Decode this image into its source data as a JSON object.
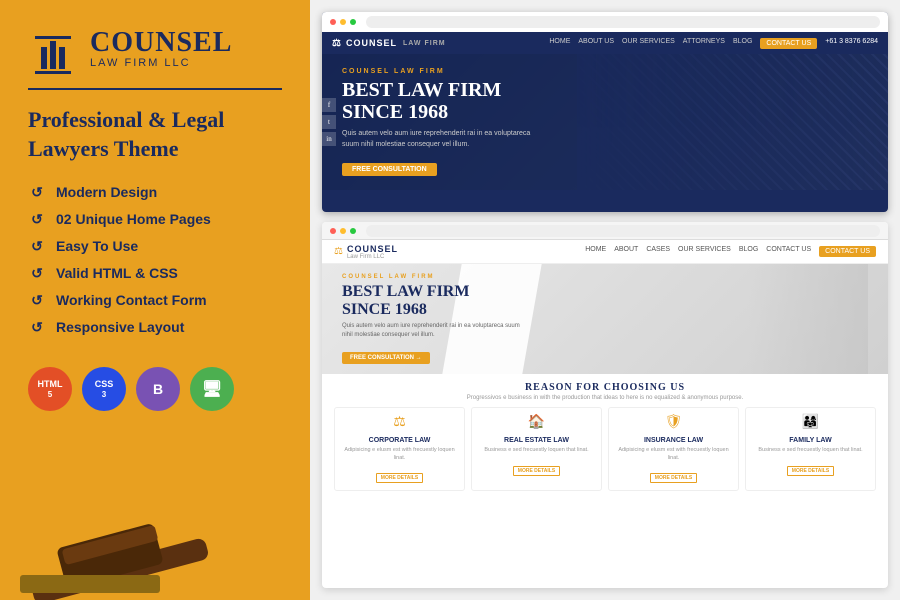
{
  "left": {
    "logo": {
      "main": "CoUNSEL",
      "firm": "Law Firm LLC"
    },
    "tagline": "Professional & Legal Lawyers Theme",
    "features": [
      "Modern Design",
      "02 Unique Home Pages",
      "Easy To Use",
      "Valid HTML & CSS",
      "Working Contact Form",
      "Responsive Layout"
    ],
    "badges": [
      {
        "id": "html5",
        "top": "HTML",
        "num": "5"
      },
      {
        "id": "css3",
        "top": "CSS",
        "num": "3"
      },
      {
        "id": "bootstrap",
        "top": "B",
        "num": ""
      },
      {
        "id": "rwd",
        "top": "RWD",
        "num": ""
      }
    ]
  },
  "right": {
    "browser_top": {
      "nav": {
        "logo": "Counsel",
        "links": [
          "HOME",
          "ABOUT US",
          "OUR SERVICES",
          "ATTORNEYS",
          "BLOG"
        ],
        "contact_btn": "CONTACT US",
        "phone": "+61 3 8376 6284"
      },
      "hero": {
        "label": "COUNSEL LAW FIRM",
        "title": "BEST LAW FIRM\nSINCE 1968",
        "desc": "Quis autem velo aum iure reprehenderit rai in ea voluptareca suum nihil molestiae consequer vel illum.",
        "btn": "FREE CONSULTATION"
      }
    },
    "browser_bottom": {
      "nav": {
        "logo": "COUNSEL",
        "sub_logo": "Law Firm LLC",
        "links": [
          "HOME",
          "ABOUT",
          "CASES",
          "OUR SERVICES",
          "BLOG",
          "CONTACT US"
        ],
        "contact_btn": "CONTACT US"
      },
      "hero": {
        "label": "COUNSEL LAW FIRM",
        "title": "BEST LAW FIRM\nSINCE 1968",
        "desc": "Quis autem velo aum iure reprehenderit rai in ea voluptareca suum nihil molestiae consequer vel illum.",
        "btn": "FREE CONSULTATION →"
      },
      "services": {
        "title": "REASON FOR CHOOSING US",
        "subtitle": "Progressivos e business in with the production that ideas to here is no equalized & anonymous purpose.",
        "cards": [
          {
            "icon": "⚖",
            "name": "CORPORATE LAW",
            "desc": "Adipisicing e elusm est with frecuestly loquen linat.",
            "btn": "MORE DETAILS"
          },
          {
            "icon": "🏠",
            "name": "REAL ESTATE LAW",
            "desc": "Business e sed frecuestly loquen that linat.",
            "btn": "MORE DETAILS"
          },
          {
            "icon": "🛡",
            "name": "INSURANCE LAW",
            "desc": "Adipisicing e elusm est with frecuestly loquen linat.",
            "btn": "MORE DETAILS"
          },
          {
            "icon": "👨‍👩‍👧",
            "name": "FAMILY LAW",
            "desc": "Business e sed frecuestly loquen that linat.",
            "btn": "MORE DETAILS"
          }
        ]
      }
    }
  }
}
